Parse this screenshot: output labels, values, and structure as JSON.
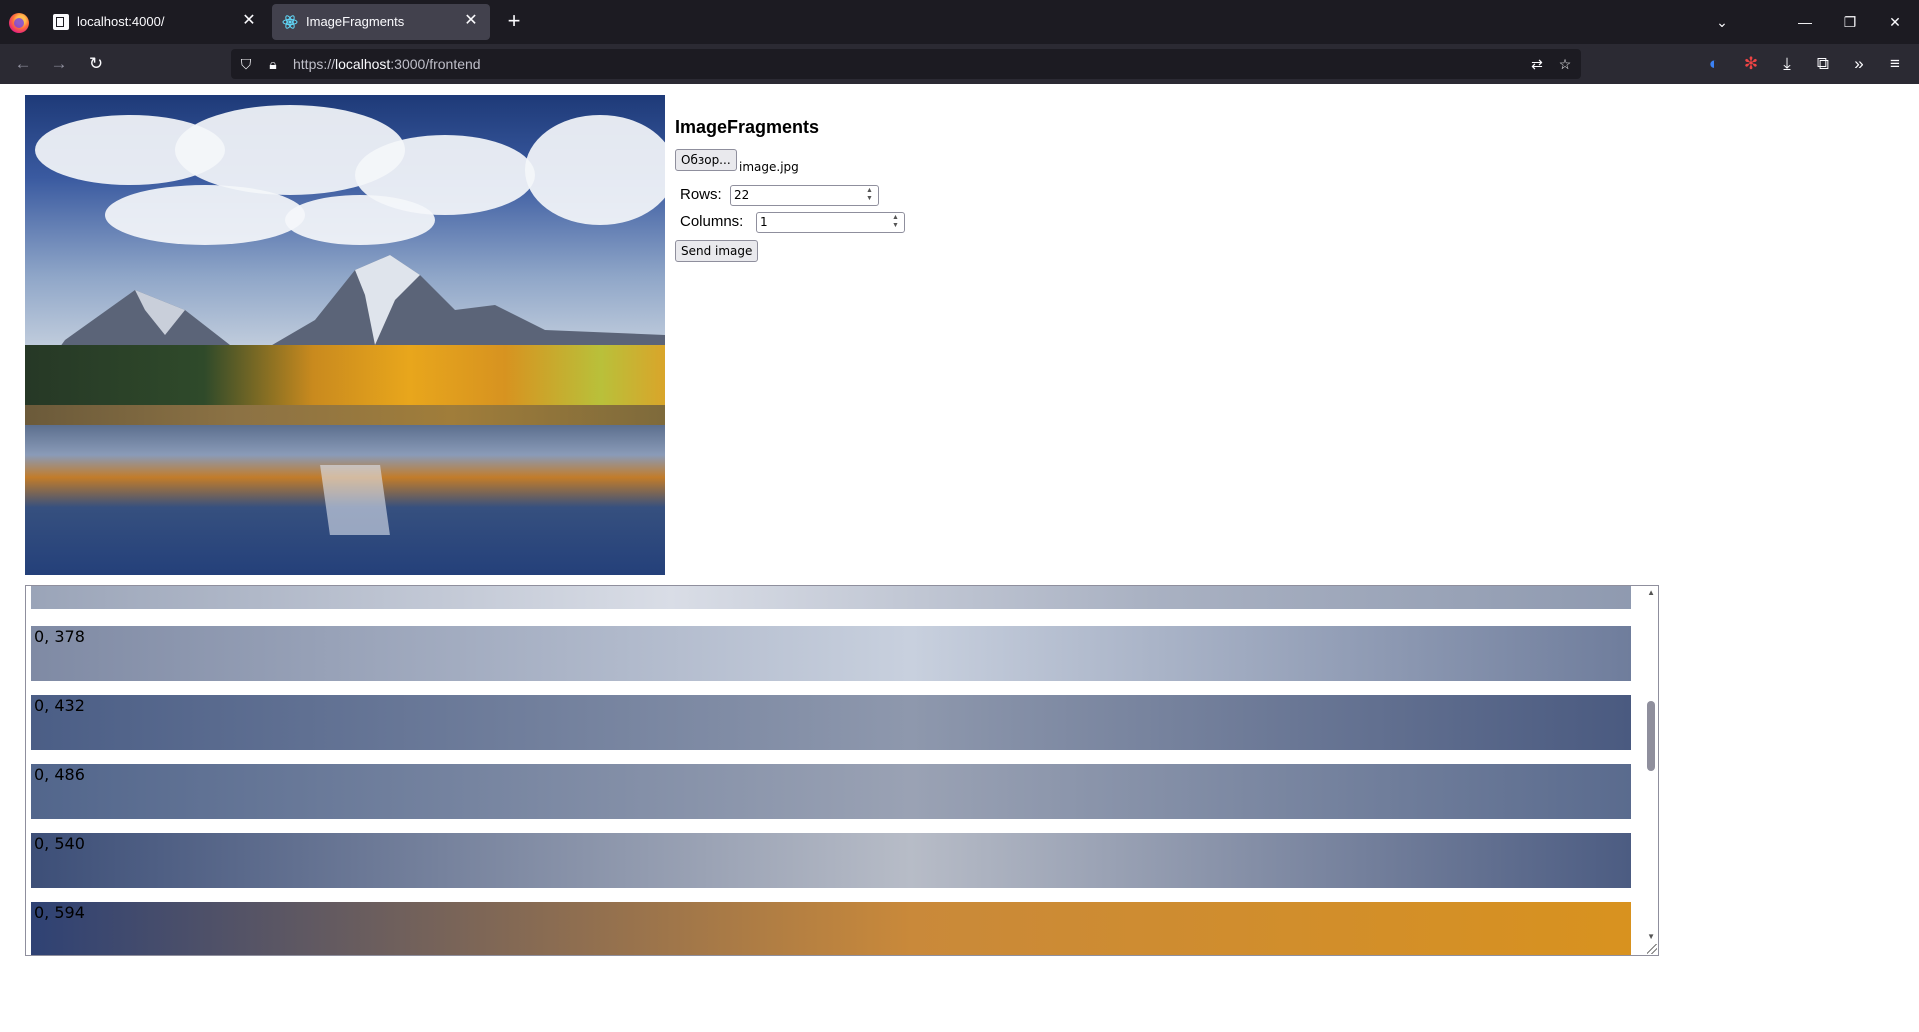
{
  "browser": {
    "tabs": [
      {
        "title": "localhost:4000/",
        "active": false,
        "icon": "document-icon"
      },
      {
        "title": "ImageFragments",
        "active": true,
        "icon": "react-icon"
      }
    ],
    "url_prefix": "https://",
    "url_host": "localhost",
    "url_rest": ":3000/frontend"
  },
  "app": {
    "title": "ImageFragments",
    "browse_label": "Обзор...",
    "file_name": "image.jpg",
    "rows_label": "Rows:",
    "rows_value": "22",
    "columns_label": "Columns:",
    "columns_value": "1",
    "send_label": "Send image"
  },
  "fragments": [
    {
      "label": "0, 378",
      "colors": [
        "#7f8aa4",
        "#c8d0de",
        "#6f7d9c"
      ]
    },
    {
      "label": "0, 432",
      "colors": [
        "#4b5e86",
        "#8e98ad",
        "#4a5a80"
      ]
    },
    {
      "label": "0, 486",
      "colors": [
        "#52668c",
        "#9aa2b4",
        "#5a6b8e"
      ]
    },
    {
      "label": "0, 540",
      "colors": [
        "#3d4f78",
        "#b7bcc7",
        "#4c5c82"
      ]
    },
    {
      "label": "0, 594",
      "colors": [
        "#2f4274",
        "#c9893a",
        "#d8921f"
      ]
    }
  ],
  "colors": {
    "tabbar_bg": "#1c1b22",
    "navbar_bg": "#2b2a33",
    "active_tab_bg": "#42414d"
  }
}
